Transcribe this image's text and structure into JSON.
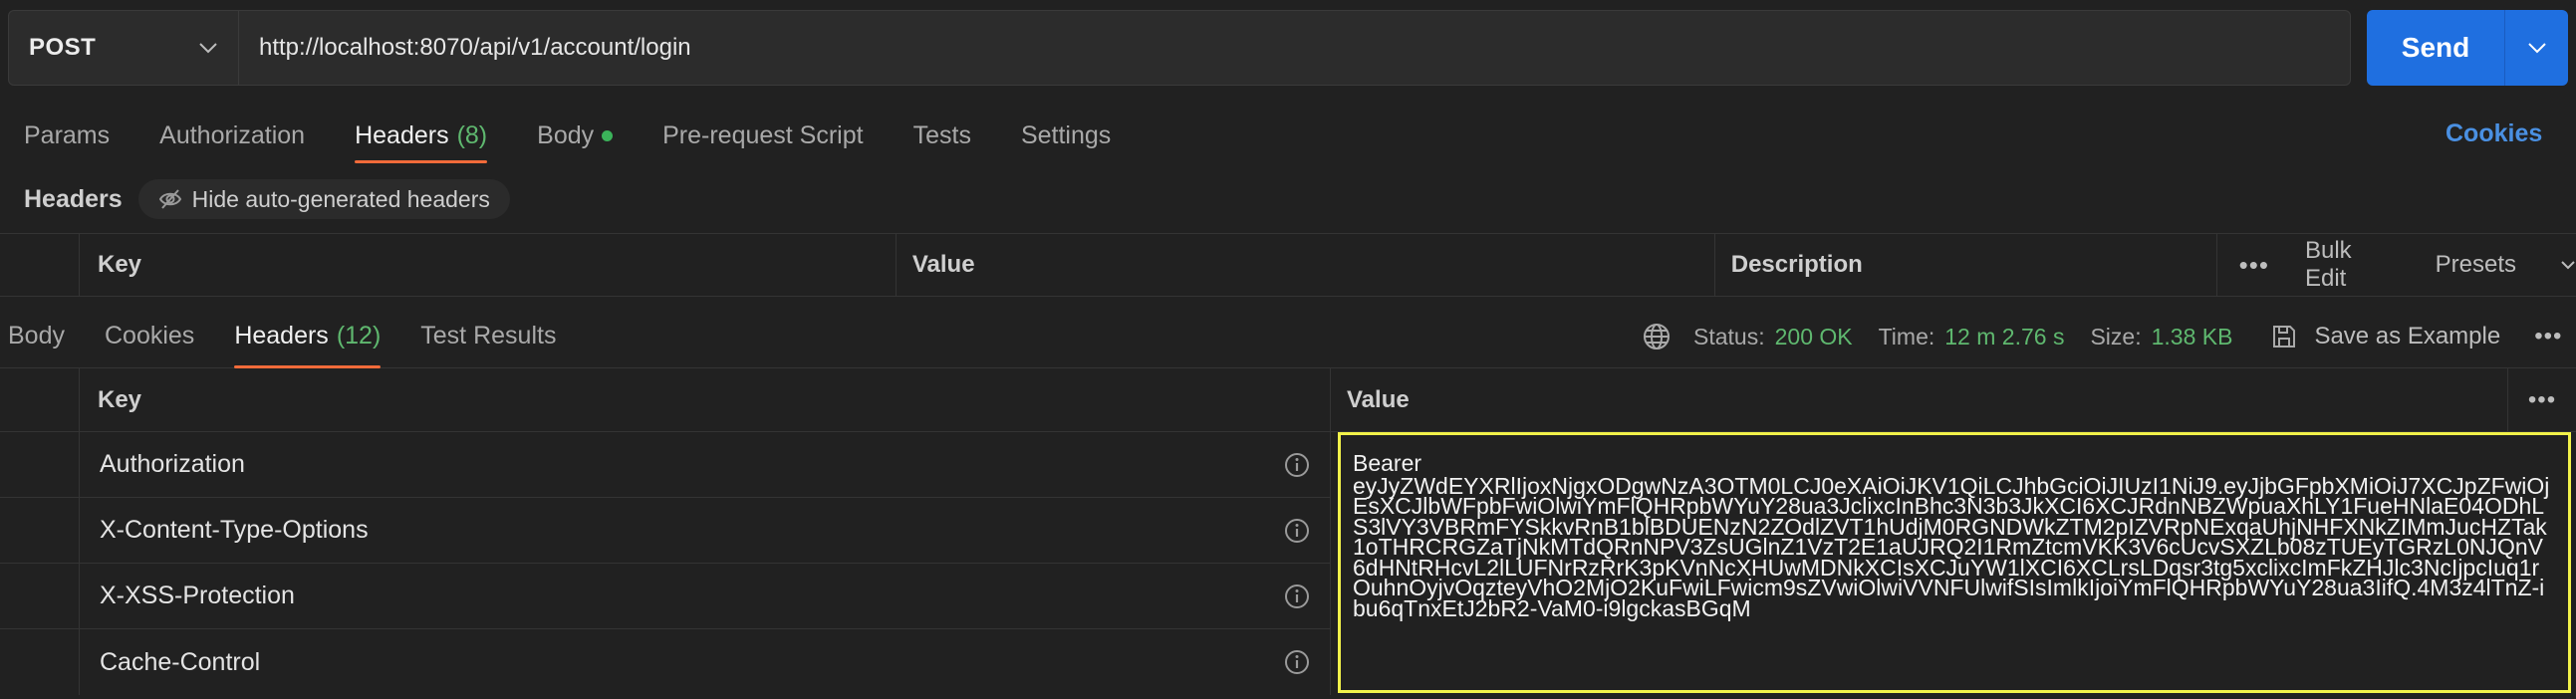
{
  "request": {
    "method": "POST",
    "url": "http://localhost:8070/api/v1/account/login",
    "send_label": "Send"
  },
  "request_tabs": [
    {
      "label": "Params"
    },
    {
      "label": "Authorization"
    },
    {
      "label": "Headers",
      "count": "(8)"
    },
    {
      "label": "Body"
    },
    {
      "label": "Pre-request Script"
    },
    {
      "label": "Tests"
    },
    {
      "label": "Settings"
    }
  ],
  "cookies_link": "Cookies",
  "headers_section": {
    "title": "Headers",
    "hide_auto_label": "Hide auto-generated headers"
  },
  "request_table": {
    "columns": [
      "Key",
      "Value",
      "Description"
    ],
    "bulk_edit": "Bulk Edit",
    "presets": "Presets"
  },
  "response_tabs": [
    {
      "label": "Body"
    },
    {
      "label": "Cookies"
    },
    {
      "label": "Headers",
      "count": "(12)"
    },
    {
      "label": "Test Results"
    }
  ],
  "response_status": {
    "status_label": "Status:",
    "status_value": "200 OK",
    "time_label": "Time:",
    "time_value": "12 m 2.76 s",
    "size_label": "Size:",
    "size_value": "1.38 KB",
    "save_example": "Save as Example"
  },
  "response_table": {
    "columns": [
      "Key",
      "Value"
    ],
    "rows": [
      {
        "key": "Authorization"
      },
      {
        "key": "X-Content-Type-Options"
      },
      {
        "key": "X-XSS-Protection"
      },
      {
        "key": "Cache-Control"
      }
    ],
    "authorization_value_line1": "Bearer",
    "authorization_value_token": "eyJyZWdEYXRlIjoxNjgxODgwNzA3OTM0LCJ0eXAiOiJKV1QiLCJhbGciOiJIUzI1NiJ9.eyJjbGFpbXMiOiJ7XCJpZFwiOjEsXCJlbWFpbFwiOlwiYmFlQHRpbWYuY28ua3JclixcInBhc3N3b3JkXCI6XCJRdnNBZWpuaXhLY1FueHNlaE04ODhLS3lVY3VBRmFYSkkvRnB1blBDUENzN2ZOdlZVT1hUdjM0RGNDWkZTM2pIZVRpNExqaUhjNHFXNkZIMmJucHZTak1oTHRCRGZaTjNkMTdQRnNPV3ZsUGlnZ1VzT2E1aUJRQ2I1RmZtcmVKK3V6cUcvSXZLb08zTUEyTGRzL0NJQnV6dHNtRHcvL2lLUFNrRzRrK3pKVnNcXHUwMDNkXCIsXCJuYW1lXCI6XCLrsLDqsr3tg5xclixcImFkZHJlc3NcIjpcIuq1rOuhnOyjvOqzteyVhO2MjO2KuFwiLFwicm9sZVwiOlwiVVNFUlwifSIsImlkIjoiYmFlQHRpbWYuY28ua3IifQ.4M3z4lTnZ-ibu6qTnxEtJ2bR2-VaM0-i9lgckasBGqM"
  },
  "colors": {
    "accent_send": "#1f6fe0",
    "tab_underline": "#f26b3a",
    "success": "#5fb86f",
    "link": "#4a90e2",
    "highlight": "#f2f24a"
  }
}
